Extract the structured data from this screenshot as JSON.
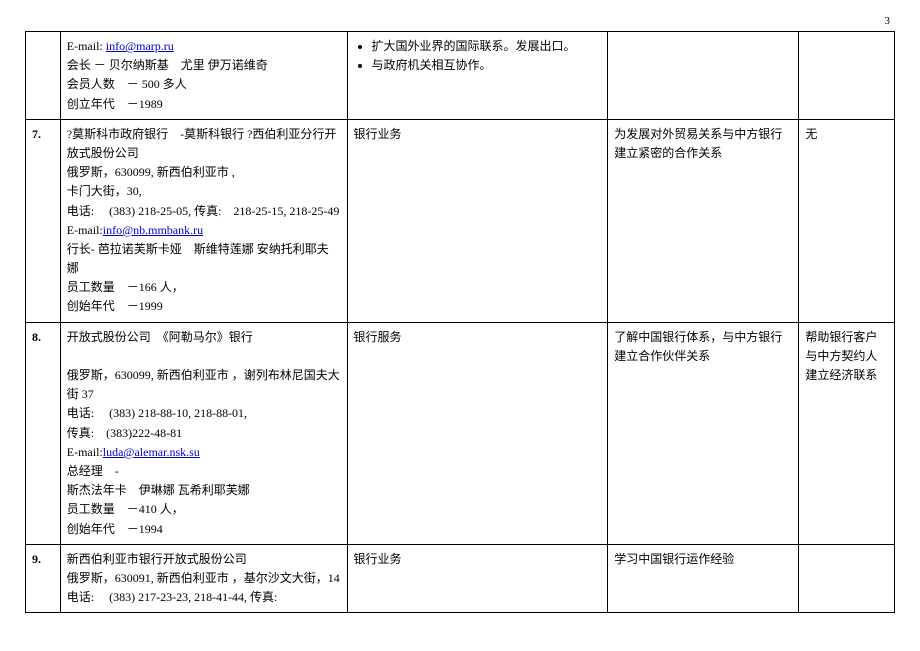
{
  "page_number": "3",
  "rows": [
    {
      "num": "",
      "col2_lines": [
        "E-mail: ",
        "会长 － 贝尔纳斯基　尤里  伊万诺维奇",
        "会员人数　－  500 多人",
        "创立年代　－1989"
      ],
      "col2_email": "info@marp.ru",
      "col3_bullets": [
        "扩大国外业界的国际联系。发展出口。",
        "与政府机关相互协作。"
      ],
      "col4": "",
      "col5": ""
    },
    {
      "num": "7.",
      "col2_lines": [
        "?莫斯科市政府银行　-莫斯科银行  ?西伯利亚分行开放式股份公司",
        "俄罗斯，630099,  新西伯利亚市 ,",
        "卡门大街，30,",
        "电话:　 (383) 218-25-05,  传真:　218-25-15, 218-25-49",
        "E-mail:",
        "行长-  芭拉诺芙斯卡娅　斯维特莲娜  安纳托利耶夫娜",
        "员工数量　－166 人，",
        "创始年代　－1999"
      ],
      "col2_email": "info@nb.mmbank.ru",
      "col3_text": "银行业务",
      "col4": "为发展对外贸易关系与中方银行建立紧密的合作关系",
      "col5": "无"
    },
    {
      "num": "8.",
      "col2_lines": [
        "开放式股份公司　《阿勒马尔》银行",
        "",
        "俄罗斯，630099,  新西伯利亚市 ，谢列布林尼国夫大街  37",
        "电话:　 (383) 218-88-10, 218-88-01,",
        "传真:　(383)222-48-81",
        "E-mail:",
        "总经理　-",
        "斯杰法年卡　伊琳娜  瓦希利耶芙娜",
        "员工数量　－410 人，",
        "创始年代　－1994"
      ],
      "col2_email": "luda@alemar.nsk.su",
      "col3_text": "银行服务",
      "col4": "了解中国银行体系，与中方银行建立合作伙伴关系",
      "col5": "帮助银行客户与中方契约人建立经济联系"
    },
    {
      "num": "9.",
      "col2_lines": [
        "新西伯利亚市银行开放式股份公司",
        "俄罗斯，630091,  新西伯利亚市 ，基尔沙文大街，14",
        "电话:　 (383) 217-23-23, 218-41-44, 传真:"
      ],
      "col2_email": "",
      "col3_text": "银行业务",
      "col4": "学习中国银行运作经验",
      "col5": ""
    }
  ]
}
